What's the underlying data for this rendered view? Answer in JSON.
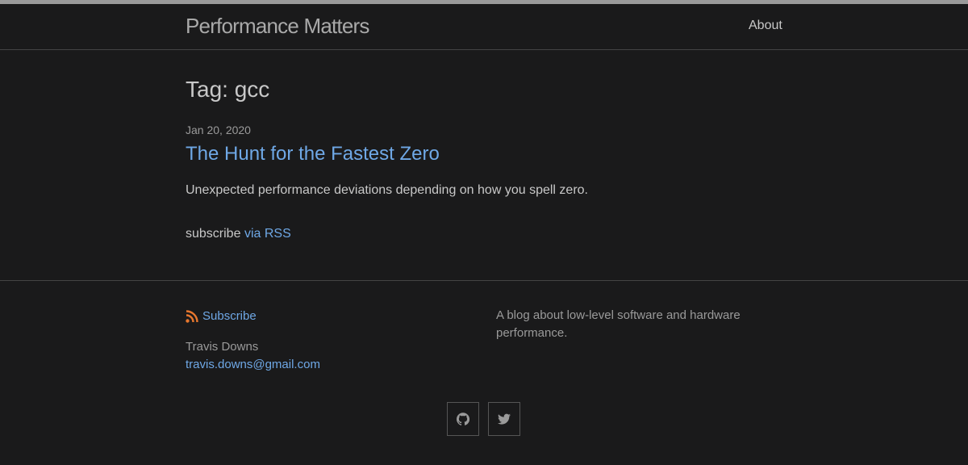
{
  "header": {
    "site_title": "Performance Matters",
    "nav": {
      "about": "About"
    }
  },
  "main": {
    "heading": "Tag: gcc",
    "posts": [
      {
        "date": "Jan 20, 2020",
        "title": "The Hunt for the Fastest Zero",
        "excerpt": "Unexpected performance deviations depending on how you spell zero."
      }
    ],
    "subscribe": {
      "prefix": "subscribe",
      "link_label": "via RSS"
    }
  },
  "footer": {
    "subscribe_label": "Subscribe",
    "author": "Travis Downs",
    "email": "travis.downs@gmail.com",
    "description": "A blog about low-level software and hardware performance.",
    "social": [
      {
        "icon": "github-icon"
      },
      {
        "icon": "twitter-icon"
      }
    ]
  },
  "colors": {
    "background": "#1a1a1b",
    "link": "#6fa8e6",
    "rss": "#e8772e",
    "text": "#c8c8c8",
    "muted": "#9a9a9a"
  }
}
